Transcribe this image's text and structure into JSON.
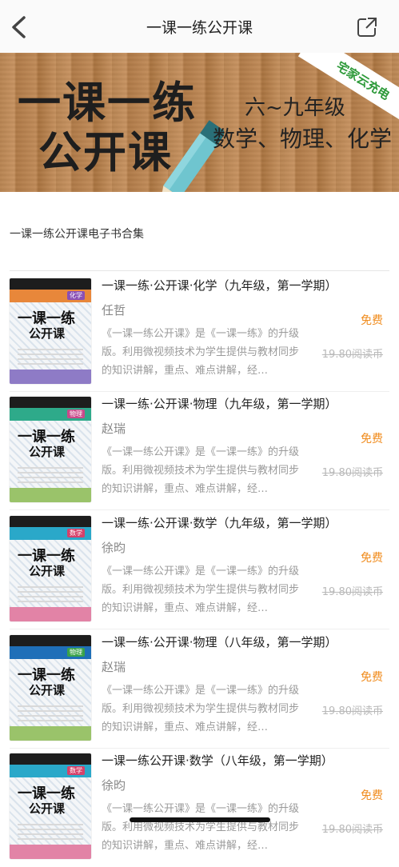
{
  "nav": {
    "title": "一课一练公开课",
    "back_icon": "chevron-left-icon",
    "share_icon": "share-icon"
  },
  "banner": {
    "line1": "一课一练",
    "line2": "公开课",
    "grade": "六~九年级",
    "subjects": "数学、物理、化学",
    "ribbon": "宅家云充电"
  },
  "section_label": "一课一练公开课电子书合集",
  "books": [
    {
      "title": "一课一练·公开课·化学（九年级，第一学期）",
      "author": "任哲",
      "desc": "《一课一练公开课》是《一课一练》的升级版。利用微视频技术为学生提供与教材同步的知识讲解，重点、难点讲解，经…",
      "free_label": "免费",
      "price": "19.80阅读币",
      "cover": {
        "line1": "一课一练",
        "line2": "公开课",
        "tag": "化学",
        "band_color": "#e8873a",
        "tag_color": "#8a4fb5",
        "bottom_color": "#8e7bc6"
      }
    },
    {
      "title": "一课一练·公开课·物理（九年级，第一学期）",
      "author": "赵瑞",
      "desc": "《一课一练公开课》是《一课一练》的升级版。利用微视频技术为学生提供与教材同步的知识讲解，重点、难点讲解，经…",
      "free_label": "免费",
      "price": "19.80阅读币",
      "cover": {
        "line1": "一课一练",
        "line2": "公开课",
        "tag": "物理",
        "band_color": "#2eaa8a",
        "tag_color": "#c94a8a",
        "bottom_color": "#9ac36a"
      }
    },
    {
      "title": "一课一练·公开课·数学（九年级，第一学期）",
      "author": "徐昀",
      "desc": "《一课一练公开课》是《一课一练》的升级版。利用微视频技术为学生提供与教材同步的知识讲解，重点、难点讲解，经…",
      "free_label": "免费",
      "price": "19.80阅读币",
      "cover": {
        "line1": "一课一练",
        "line2": "公开课",
        "tag": "数学",
        "band_color": "#2aa8c9",
        "tag_color": "#d6416a",
        "bottom_color": "#e283a6"
      }
    },
    {
      "title": "一课一练·公开课·物理（八年级，第一学期）",
      "author": "赵瑞",
      "desc": "《一课一练公开课》是《一课一练》的升级版。利用微视频技术为学生提供与教材同步的知识讲解，重点、难点讲解，经…",
      "free_label": "免费",
      "price": "19.80阅读币",
      "cover": {
        "line1": "一课一练",
        "line2": "公开课",
        "tag": "物理",
        "band_color": "#1f6fb8",
        "tag_color": "#3aa34a",
        "bottom_color": "#9ac36a"
      }
    },
    {
      "title": "一课一练公开课·数学（八年级，第一学期）",
      "author": "徐昀",
      "desc": "《一课一练公开课》是《一课一练》的升级版。利用微视频技术为学生提供与教材同步的知识讲解，重点、难点讲解，经…",
      "free_label": "免费",
      "price": "19.80阅读币",
      "cover": {
        "line1": "一课一练",
        "line2": "公开课",
        "tag": "数学",
        "band_color": "#2aa8c9",
        "tag_color": "#d6416a",
        "bottom_color": "#e283a6"
      }
    }
  ]
}
